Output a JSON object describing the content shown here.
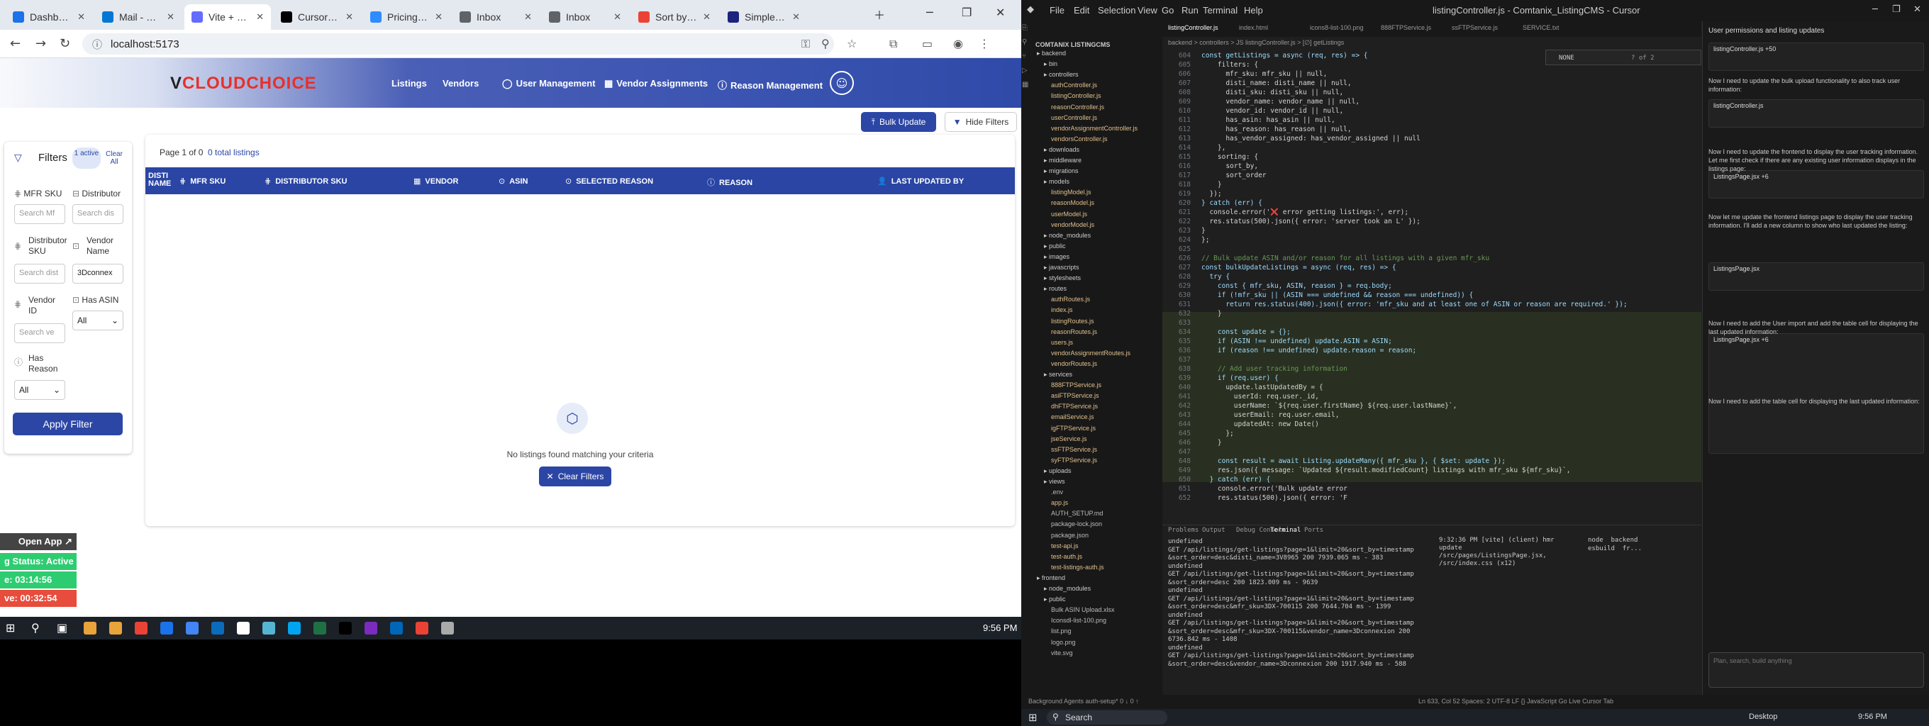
{
  "browser": {
    "tabs": [
      {
        "label": "Dashboard",
        "color": "#1a73e8"
      },
      {
        "label": "Mail - Has...",
        "color": "#0078d4"
      },
      {
        "label": "Vite + Rea...",
        "color": "#646cff"
      },
      {
        "label": "Cursor - Th...",
        "color": "#000000"
      },
      {
        "label": "Pricing Ch...",
        "color": "#2d8cff"
      },
      {
        "label": "Inbox",
        "color": "#5f6368"
      },
      {
        "label": "Inbox",
        "color": "#5f6368"
      },
      {
        "label": "Sort by ve...",
        "color": "#ea4335"
      },
      {
        "label": "Simple Da...",
        "color": "#1a237e"
      }
    ],
    "url": "localhost:5173"
  },
  "app": {
    "logo_v": "V",
    "logo_text": "CLOUDCHOICE",
    "nav": [
      {
        "label": "Listings",
        "icon": ""
      },
      {
        "label": "Vendors",
        "icon": ""
      },
      {
        "label": "User Management",
        "icon": "◯"
      },
      {
        "label": "Vendor Assignments",
        "icon": "▦"
      },
      {
        "label": "Reason Management",
        "icon": "ⓘ"
      }
    ],
    "bulk_update": "Bulk Update",
    "hide_filters": "Hide Filters",
    "filters": {
      "title": "Filters",
      "active": "1 active",
      "clear_all": "Clear All",
      "mfr_sku": "MFR SKU",
      "mfr_placeholder": "Search Mf",
      "distributor": "Distributor",
      "distributor_placeholder": "Search dis",
      "distributor_sku": "Distributor SKU",
      "distributor_sku_placeholder": "Search dist",
      "vendor_name": "Vendor Name",
      "vendor_name_value": "3Dconnex",
      "vendor_id": "Vendor ID",
      "vendor_id_placeholder": "Search ve",
      "has_asin": "Has ASIN",
      "has_asin_value": "All",
      "has_reason": "Has Reason",
      "has_reason_value": "All",
      "apply": "Apply Filter"
    },
    "page_info": "Page 1 of 0",
    "total": "0 total listings",
    "columns": [
      "DISTI NAME",
      "MFR SKU",
      "DISTRIBUTOR SKU",
      "VENDOR",
      "ASIN",
      "SELECTED REASON",
      "REASON",
      "LAST UPDATED BY"
    ],
    "empty_text": "No listings found matching your criteria",
    "clear_filters": "Clear Filters"
  },
  "sidebar_widget": {
    "open_app": "Open App ↗",
    "status": "g Status: Active",
    "timer1": "e: 03:14:56",
    "timer2": "ve: 00:32:54"
  },
  "taskbar_left": {
    "time": "9:56 PM"
  },
  "vscode": {
    "menus": [
      "File",
      "Edit",
      "Selection",
      "View",
      "Go",
      "Run",
      "Terminal",
      "Help"
    ],
    "title": "listingController.js - Comtanix_ListingCMS - Cursor",
    "explorer_title": "COMTANIX LISTINGCMS",
    "tree": [
      "backend",
      "bin",
      "controllers",
      "authController.js",
      "listingController.js",
      "reasonController.js",
      "userController.js",
      "vendorAssignmentController.js",
      "vendorsController.js",
      "downloads",
      "middleware",
      "migrations",
      "models",
      "listingModel.js",
      "reasonModel.js",
      "userModel.js",
      "vendorModel.js",
      "node_modules",
      "public",
      "images",
      "javascripts",
      "stylesheets",
      "routes",
      "authRoutes.js",
      "index.js",
      "listingRoutes.js",
      "reasonRoutes.js",
      "users.js",
      "vendorAssignmentRoutes.js",
      "vendorRoutes.js",
      "services",
      "888FTPService.js",
      "asiFTPService.js",
      "dhFTPService.js",
      "emailService.js",
      "igFTPService.js",
      "jseService.js",
      "ssFTPService.js",
      "syFTPService.js",
      "uploads",
      "views",
      ".env",
      "app.js",
      "AUTH_SETUP.md",
      "package-lock.json",
      "package.json",
      "test-api.js",
      "test-auth.js",
      "test-listings-auth.js",
      "frontend",
      "node_modules",
      "public",
      "Bulk ASIN Upload.xlsx",
      "Iconsdl-list-100.png",
      "list.png",
      "logo.png",
      "vite.svg"
    ],
    "editor_tabs": [
      "listingController.js",
      "index.html",
      "icons8-list-100.png",
      "888FTPService.js",
      "ssFTPService.js",
      "SERVICE.txt"
    ],
    "breadcrumb": "backend > controllers > JS listingController.js > [∅] getListings",
    "find_text": "NONE",
    "find_count": "? of 2",
    "code": [
      {
        "n": "604",
        "t": "const getListings = async (req, res) => {"
      },
      {
        "n": "605",
        "t": "    filters: {"
      },
      {
        "n": "606",
        "t": "      mfr_sku: mfr_sku || null,"
      },
      {
        "n": "607",
        "t": "      disti_name: disti_name || null,"
      },
      {
        "n": "608",
        "t": "      disti_sku: disti_sku || null,"
      },
      {
        "n": "609",
        "t": "      vendor_name: vendor_name || null,"
      },
      {
        "n": "610",
        "t": "      vendor_id: vendor_id || null,"
      },
      {
        "n": "611",
        "t": "      has_asin: has_asin || null,"
      },
      {
        "n": "612",
        "t": "      has_reason: has_reason || null,"
      },
      {
        "n": "613",
        "t": "      has_vendor_assigned: has_vendor_assigned || null"
      },
      {
        "n": "614",
        "t": "    },"
      },
      {
        "n": "615",
        "t": "    sorting: {"
      },
      {
        "n": "616",
        "t": "      sort_by,"
      },
      {
        "n": "617",
        "t": "      sort_order"
      },
      {
        "n": "618",
        "t": "    }"
      },
      {
        "n": "619",
        "t": "  });"
      },
      {
        "n": "620",
        "t": "} catch (err) {"
      },
      {
        "n": "621",
        "t": "  console.error('❌ error getting listings:', err);"
      },
      {
        "n": "622",
        "t": "  res.status(500).json({ error: 'server took an L' });"
      },
      {
        "n": "623",
        "t": "}"
      },
      {
        "n": "624",
        "t": "};"
      },
      {
        "n": "625",
        "t": ""
      },
      {
        "n": "626",
        "t": "// Bulk update ASIN and/or reason for all listings with a given mfr_sku"
      },
      {
        "n": "627",
        "t": "const bulkUpdateListings = async (req, res) => {"
      },
      {
        "n": "628",
        "t": "  try {"
      },
      {
        "n": "629",
        "t": "    const { mfr_sku, ASIN, reason } = req.body;"
      },
      {
        "n": "630",
        "t": "    if (!mfr_sku || (ASIN === undefined && reason === undefined)) {"
      },
      {
        "n": "631",
        "t": "      return res.status(400).json({ error: 'mfr_sku and at least one of ASIN or reason are required.' });"
      },
      {
        "n": "632",
        "t": "    }"
      },
      {
        "n": "633",
        "t": ""
      },
      {
        "n": "634",
        "t": "    const update = {};"
      },
      {
        "n": "635",
        "t": "    if (ASIN !== undefined) update.ASIN = ASIN;"
      },
      {
        "n": "636",
        "t": "    if (reason !== undefined) update.reason = reason;"
      },
      {
        "n": "637",
        "t": ""
      },
      {
        "n": "638",
        "t": "    // Add user tracking information"
      },
      {
        "n": "639",
        "t": "    if (req.user) {"
      },
      {
        "n": "640",
        "t": "      update.lastUpdatedBy = {"
      },
      {
        "n": "641",
        "t": "        userId: req.user._id,"
      },
      {
        "n": "642",
        "t": "        userName: `${req.user.firstName} ${req.user.lastName}`,"
      },
      {
        "n": "643",
        "t": "        userEmail: req.user.email,"
      },
      {
        "n": "644",
        "t": "        updatedAt: new Date()"
      },
      {
        "n": "645",
        "t": "      };"
      },
      {
        "n": "646",
        "t": "    }"
      },
      {
        "n": "647",
        "t": ""
      },
      {
        "n": "648",
        "t": "    const result = await Listing.updateMany({ mfr_sku }, { $set: update });"
      },
      {
        "n": "649",
        "t": "    res.json({ message: `Updated ${result.modifiedCount} listings with mfr_sku ${mfr_sku}`,"
      },
      {
        "n": "650",
        "t": "  } catch (err) {"
      },
      {
        "n": "651",
        "t": "    console.error('Bulk update error"
      },
      {
        "n": "652",
        "t": "    res.status(500).json({ error: 'F"
      }
    ],
    "panel_tabs": [
      "Problems",
      "Output",
      "Debug Console",
      "Terminal",
      "Ports"
    ],
    "terminal_lines": [
      "undefined",
      "GET /api/listings/get-listings?page=1&limit=20&sort_by=timestamp",
      "&sort_order=desc&disti_name=3V8965 200 7939.065 ms - 383",
      "undefined",
      "GET /api/listings/get-listings?page=1&limit=20&sort_by=timestamp",
      "&sort_order=desc 200 1823.009 ms - 9639",
      "undefined",
      "GET /api/listings/get-listings?page=1&limit=20&sort_by=timestamp",
      "&sort_order=desc&mfr_sku=3DX-700115 200 7644.704 ms - 1399",
      "undefined",
      "GET /api/listings/get-listings?page=1&limit=20&sort_by=timestamp",
      "&sort_order=desc&mfr_sku=3DX-700115&vendor_name=3Dconnexion 200",
      "6736.842 ms - 1408",
      "undefined",
      "GET /api/listings/get-listings?page=1&limit=20&sort_by=timestamp",
      "&sort_order=desc&vendor_name=3Dconnexion 200 1917.940 ms - 588"
    ],
    "terminal2": "9:32:36 PM [vite] (client) hmr update /src/pages/ListingsPage.jsx, /src/index.css (x12)",
    "terminal_tabs": [
      "node  backend",
      "esbuild  fr..."
    ],
    "chat_title": "User permissions and listing updates",
    "chat_msgs": [
      "Now I need to update the bulk upload functionality to also track user information:",
      "Now I need to update the frontend to display the user tracking information. Let me first check if there are any existing user information displays in the listings page:",
      "Now let me update the frontend listings page to display the user tracking information. I'll add a new column to show who last updated the listing:",
      "Now I need to add the User import and add the table cell for displaying the last updated information:",
      "Now I need to add the table cell for displaying the last updated information:"
    ],
    "chat_files": [
      "listingController.js +50",
      "listingController.js",
      "ListingsPage.jsx +6",
      "ListingsPage.jsx",
      "ListingsPage.jsx +6"
    ],
    "chat_input": "Plan, search, build anything",
    "status_items": "Ln 633, Col 52   Spaces: 2   UTF-8   LF   {} JavaScript   Go Live   Cursor Tab",
    "git": "Background Agents   auth-setup*   0 ↓ 0 ↑",
    "time": "9:56 PM",
    "search": "Search",
    "desktop": "Desktop"
  },
  "colors": {
    "accent": "#2a45a4",
    "green": "#2ecc71",
    "red": "#e74c3c"
  }
}
